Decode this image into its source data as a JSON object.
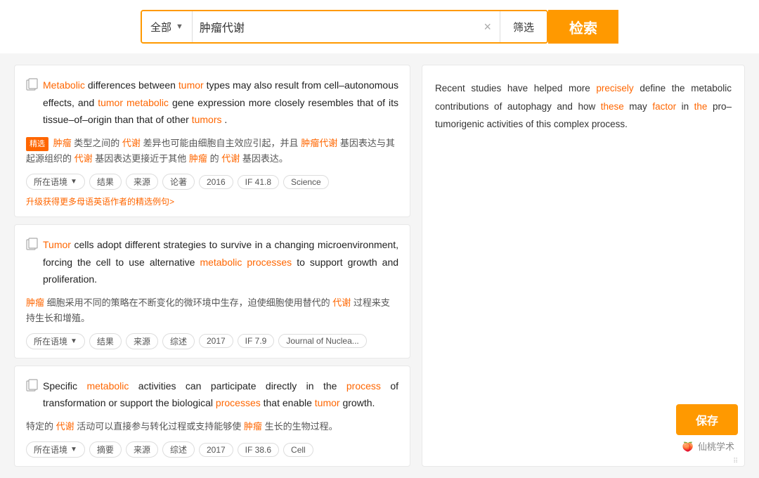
{
  "search": {
    "category": "全部",
    "chevron": "▼",
    "query": "肿瘤代谢",
    "clear_icon": "×",
    "filter_label": "筛选",
    "search_label": "检索"
  },
  "preview": {
    "text": "Recent studies have helped more precisely define the metabolic contributions of autophagy and how these may factor in the pro–tumorigenic activities of this complex process."
  },
  "results": [
    {
      "id": 1,
      "en_parts": [
        {
          "text": "Metabolic",
          "style": "orange"
        },
        {
          "text": " differences between ",
          "style": "normal"
        },
        {
          "text": "tumor",
          "style": "orange"
        },
        {
          "text": " types may also result from cell–autonomous effects, and ",
          "style": "normal"
        },
        {
          "text": "tumor",
          "style": "orange"
        },
        {
          "text": " ",
          "style": "normal"
        },
        {
          "text": "metabolic",
          "style": "orange"
        },
        {
          "text": " gene expression more closely resembles that of its tissue–of–origin than that of other ",
          "style": "normal"
        },
        {
          "text": "tumors",
          "style": "link"
        },
        {
          "text": ".",
          "style": "normal"
        }
      ],
      "zh_badge": "精选",
      "zh_text": "肿瘤类型之间的代谢差异也可能由细胞自主效应引起，并且肿瘤代谢基因表达与其起源组织的代谢基因表达更接近于其他肿瘤的代谢基因表达。",
      "zh_highlights": [
        "肿瘤",
        "代谢",
        "肿瘤代谢",
        "代谢",
        "肿瘤",
        "代谢"
      ],
      "tags": [
        "所在语境",
        "结果",
        "来源",
        "论著",
        "2016",
        "IF 41.8",
        "Science"
      ],
      "tag_chevron": [
        true,
        false,
        false,
        false,
        false,
        false,
        false
      ],
      "upgrade_text": "升级获得更多母语英语作者的精选例句>"
    },
    {
      "id": 2,
      "en_parts": [
        {
          "text": "Tumor",
          "style": "orange"
        },
        {
          "text": " cells adopt different strategies to survive in a changing microenvironment, forcing the cell to use alternative ",
          "style": "normal"
        },
        {
          "text": "metabolic processes",
          "style": "link"
        },
        {
          "text": " to support growth and proliferation.",
          "style": "normal"
        }
      ],
      "zh_badge": null,
      "zh_text": "肿瘤细胞采用不同的策略在不断变化的微环境中生存，迫使细胞使用替代的代谢过程来支持生长和增殖。",
      "zh_highlights": [
        "肿瘤",
        "代谢"
      ],
      "tags": [
        "所在语境",
        "结果",
        "来源",
        "综述",
        "2017",
        "IF 7.9",
        "Journal of Nuclea..."
      ],
      "tag_chevron": [
        true,
        false,
        false,
        false,
        false,
        false,
        false
      ]
    },
    {
      "id": 3,
      "en_parts": [
        {
          "text": "Specific ",
          "style": "normal"
        },
        {
          "text": "metabolic",
          "style": "orange"
        },
        {
          "text": " activities can participate directly in the ",
          "style": "normal"
        },
        {
          "text": "process",
          "style": "link"
        },
        {
          "text": " of transformation or support the biological ",
          "style": "normal"
        },
        {
          "text": "processes",
          "style": "link"
        },
        {
          "text": " that enable ",
          "style": "normal"
        },
        {
          "text": "tumor",
          "style": "orange"
        },
        {
          "text": " growth.",
          "style": "normal"
        }
      ],
      "zh_badge": null,
      "zh_text": "特定的代谢活动可以直接参与转化过程或支持能够使肿瘤生长的生物过程。",
      "zh_highlights": [
        "代谢",
        "肿瘤"
      ],
      "tags": [
        "所在语境",
        "摘要",
        "来源",
        "综述",
        "2017",
        "IF 38.6",
        "Cell"
      ],
      "tag_chevron": [
        true,
        false,
        false,
        false,
        false,
        false,
        false
      ]
    }
  ],
  "watermark": {
    "icon": "🍑",
    "text": "仙桃学术"
  },
  "save": {
    "label": "保存"
  }
}
